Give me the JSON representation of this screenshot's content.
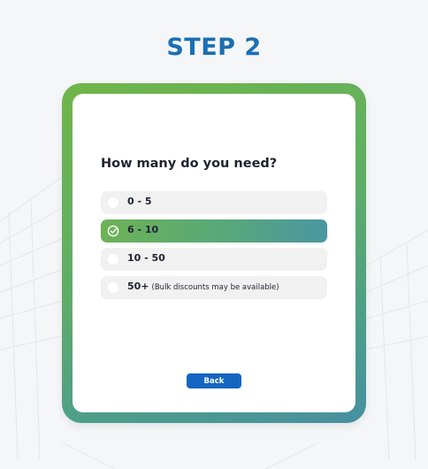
{
  "step_title": "STEP 2",
  "question": "How many do you need?",
  "options": [
    {
      "label": "0 - 5",
      "note": "",
      "selected": false
    },
    {
      "label": "6 - 10",
      "note": "",
      "selected": true
    },
    {
      "label": "10 - 50",
      "note": "",
      "selected": false
    },
    {
      "label": "50+",
      "note": "(Bulk discounts may be available)",
      "selected": false
    }
  ],
  "back_label": "Back",
  "colors": {
    "title": "#1b6fb3",
    "button": "#1565c0",
    "frame_start": "#6fb648",
    "frame_end": "#4690a2",
    "option_bg": "#f1f1f1"
  },
  "icons": {
    "selected_option": "check-circle-icon",
    "unselected_option": "radio-circle-icon"
  }
}
